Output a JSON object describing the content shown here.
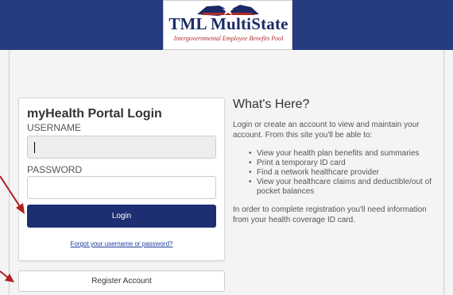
{
  "header": {
    "logo_text": "TML MultiState",
    "logo_tagline": "Intergovernmental Employee Benefits Pool"
  },
  "login": {
    "title": "myHealth Portal Login",
    "username_label": "USERNAME",
    "username_value": "",
    "password_label": "PASSWORD",
    "password_value": "",
    "login_button": "Login",
    "forgot_link": "Forgot your username or password?"
  },
  "register": {
    "button": "Register Account"
  },
  "info": {
    "title": "What's Here?",
    "intro": "Login or create an account to view and maintain your account. From this site you'll be able to:",
    "items": [
      "View your health plan benefits and summaries",
      "Print a temporary ID card",
      "Find a network healthcare provider",
      "View your healthcare claims and deductible/out of pocket balances"
    ],
    "outro": "In order to complete registration you'll need information from your health coverage ID card."
  },
  "colors": {
    "header": "#263b80",
    "button": "#1d2f72",
    "arrow": "#b02020"
  }
}
